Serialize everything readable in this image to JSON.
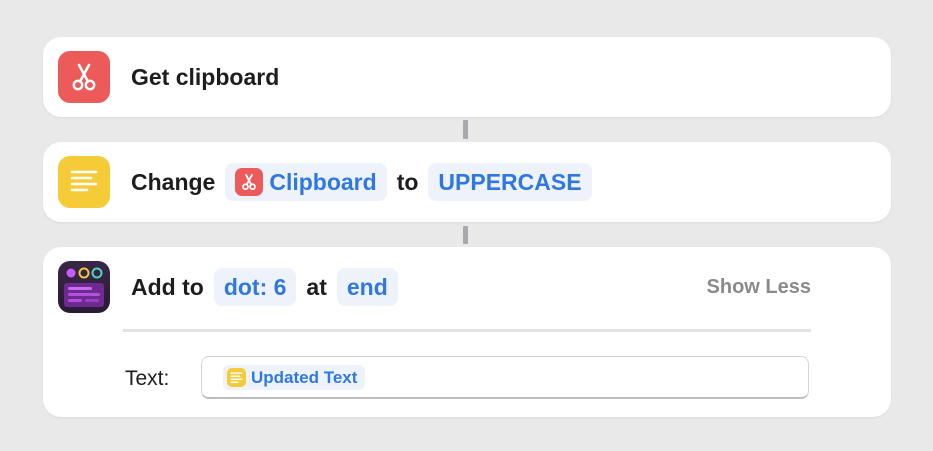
{
  "colors": {
    "background": "#e9e9e9",
    "card": "#ffffff",
    "token_bg": "#eef3fb",
    "token_text": "#2f78e2",
    "clipboard_icon": "#ec5a5a",
    "text_icon": "#f6cb38",
    "app_icon": "#2f1e3c",
    "secondary_text": "#8a8a8e"
  },
  "actions": [
    {
      "icon": "scissors-icon",
      "title": "Get clipboard"
    },
    {
      "icon": "text-lines-icon",
      "verb": "Change",
      "input_token": {
        "icon": "scissors-icon",
        "label": "Clipboard"
      },
      "connector": "to",
      "mode_token": "UPPERCASE"
    },
    {
      "icon": "dot-app-icon",
      "verb": "Add to",
      "target_token": "dot: 6",
      "connector": "at",
      "position_token": "end",
      "show_less": "Show Less",
      "text_label": "Text:",
      "text_value_token": {
        "icon": "text-lines-icon",
        "label": "Updated Text"
      }
    }
  ]
}
